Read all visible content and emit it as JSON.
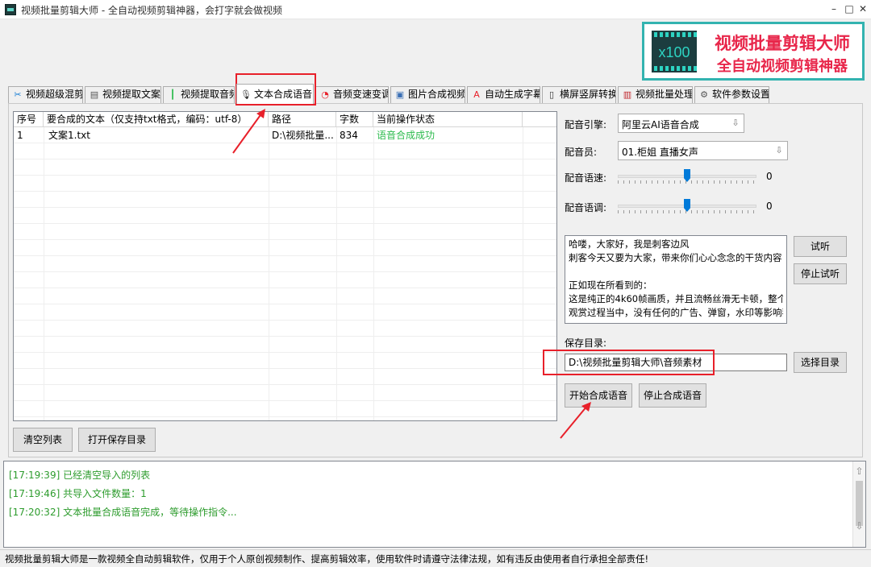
{
  "window": {
    "title": "视频批量剪辑大师 - 全自动视频剪辑神器，会打字就会做视频",
    "minimize": "–",
    "maximize": "□",
    "close": "✕"
  },
  "logo": {
    "badge": "x100",
    "line1": "视频批量剪辑大师",
    "line2": "全自动视频剪辑神器"
  },
  "tabs": [
    {
      "label": "视频超级混剪",
      "icon": "scissors-icon",
      "glyph": "✂"
    },
    {
      "label": "视频提取文案",
      "icon": "document-icon",
      "glyph": "▤"
    },
    {
      "label": "视频提取音频",
      "icon": "audio-wave-icon",
      "glyph": "┃"
    },
    {
      "label": "文本合成语音",
      "icon": "microphone-icon",
      "glyph": "🎙",
      "active": true
    },
    {
      "label": "音频变速变调",
      "icon": "gauge-icon",
      "glyph": "◔"
    },
    {
      "label": "图片合成视频",
      "icon": "image-icon",
      "glyph": "▣"
    },
    {
      "label": "自动生成字幕",
      "icon": "subtitle-icon",
      "glyph": "A"
    },
    {
      "label": "横屏竖屏转换",
      "icon": "rotate-screen-icon",
      "glyph": "▯"
    },
    {
      "label": "视频批量处理",
      "icon": "film-icon",
      "glyph": "▥"
    },
    {
      "label": "软件参数设置",
      "icon": "gear-icon",
      "glyph": "⚙"
    }
  ],
  "table": {
    "columns": [
      "序号",
      "要合成的文本（仅支持txt格式，编码：utf-8）",
      "路径",
      "字数",
      "当前操作状态"
    ],
    "rows": [
      {
        "index": "1",
        "text": "文案1.txt",
        "path": "D:\\视频批量...",
        "count": "834",
        "status": "语音合成成功"
      }
    ],
    "status_color": "#2dbb4e"
  },
  "left_buttons": {
    "clear": "清空列表",
    "open_dir": "打开保存目录"
  },
  "settings": {
    "engine_label": "配音引擎:",
    "engine_value": "阿里云AI语音合成",
    "voice_label": "配音员:",
    "voice_value": "01.柜姐 直播女声",
    "speed_label": "配音语速:",
    "speed_value": "0",
    "pitch_label": "配音语调:",
    "pitch_value": "0",
    "preview_lines": [
      "哈喽，大家好，我是刺客边风",
      "刺客今天又要为大家，带来你们心心念念的干货内容，",
      "",
      "正如现在所看到的：",
      "这是纯正的4k60帧画质，并且流畅丝滑无卡顿，整个",
      "观赏过程当中，没有任何的广告、弹窗，水印等影响我"
    ],
    "listen": "试听",
    "stop_listen": "停止试听",
    "save_label": "保存目录:",
    "save_path": "D:\\视频批量剪辑大师\\音频素材",
    "choose_dir": "选择目录",
    "start": "开始合成语音",
    "stop": "停止合成语音"
  },
  "log": {
    "lines": [
      "[17:19:39] 已经清空导入的列表",
      "[17:19:46] 共导入文件数量：1",
      "[17:20:32] 文本批量合成语音完成，等待操作指令..."
    ],
    "color": "#2e9c2e"
  },
  "status_bar": "视频批量剪辑大师是一款视频全自动剪辑软件，仅用于个人原创视频制作、提高剪辑效率，使用软件时请遵守法律法规，如有违反由使用者自行承担全部责任!",
  "annotation_color": "#e8202a"
}
